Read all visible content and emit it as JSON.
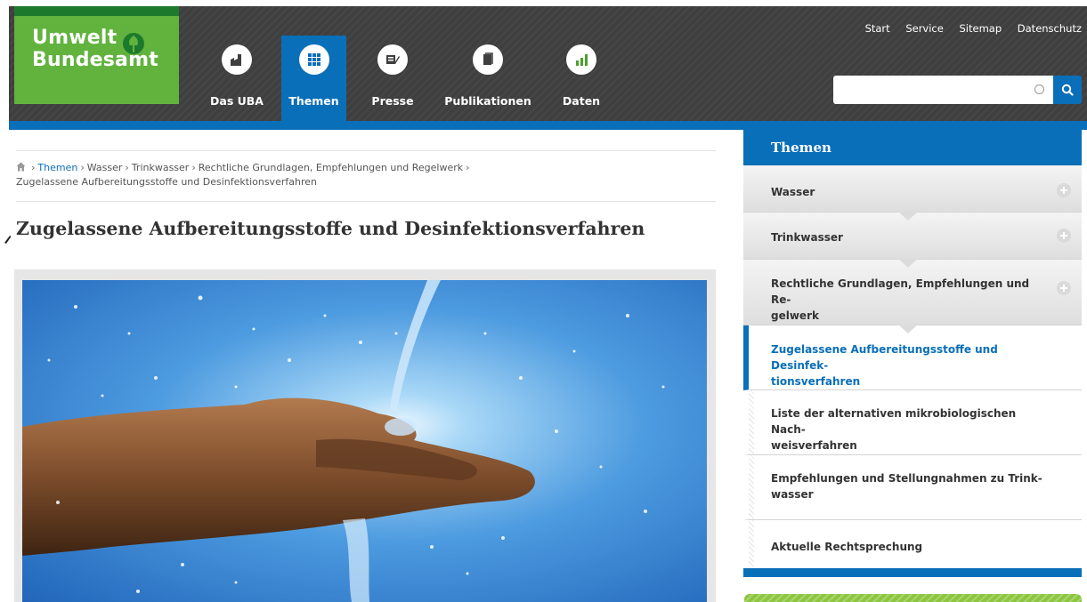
{
  "logo": {
    "line1": "Umwelt",
    "line2": "Bundesamt"
  },
  "nav": [
    {
      "label": "Das UBA",
      "icon": "factory-icon",
      "active": false
    },
    {
      "label": "Themen",
      "icon": "grid-icon",
      "active": true
    },
    {
      "label": "Presse",
      "icon": "newspaper-pen-icon",
      "active": false
    },
    {
      "label": "Publikationen",
      "icon": "book-icon",
      "active": false
    },
    {
      "label": "Daten",
      "icon": "bar-chart-icon",
      "active": false
    }
  ],
  "top_links": [
    "Start",
    "Service",
    "Sitemap",
    "Datenschutz"
  ],
  "search": {
    "value": "",
    "placeholder": ""
  },
  "breadcrumb": {
    "items": [
      "Themen",
      "Wasser",
      "Trinkwasser",
      "Rechtliche Grundlagen, Empfehlungen und Regelwerk"
    ],
    "current": "Zugelassene Aufbereitungsstoffe und Desinfektionsverfahren"
  },
  "page_title": "Zugelassene Aufbereitungsstoffe und Desinfektionsverfahren",
  "sidebar": {
    "title": "Themen",
    "items": [
      {
        "line1": "Wasser",
        "line2": "",
        "kind": "parent"
      },
      {
        "line1": "Trinkwasser",
        "line2": "",
        "kind": "parent"
      },
      {
        "line1": "Rechtliche Grundlagen, Empfehlungen und Re-",
        "line2": "gelwerk",
        "kind": "parent"
      },
      {
        "line1": "Zugelassene Aufbereitungsstoffe und Desinfek-",
        "line2": "tionsverfahren",
        "kind": "current"
      },
      {
        "line1": "Liste der alternativen mikrobiologischen Nach-",
        "line2": "weisverfahren",
        "kind": "child"
      },
      {
        "line1": "Empfehlungen und Stellungnahmen zu Trink-",
        "line2": "wasser",
        "kind": "child"
      },
      {
        "line1": "Aktuelle Rechtsprechung",
        "line2": "",
        "kind": "child"
      }
    ]
  },
  "colors": {
    "brand_blue": "#0a6fb9",
    "brand_green": "#61b33e",
    "header_dark": "#3f3f3f"
  }
}
